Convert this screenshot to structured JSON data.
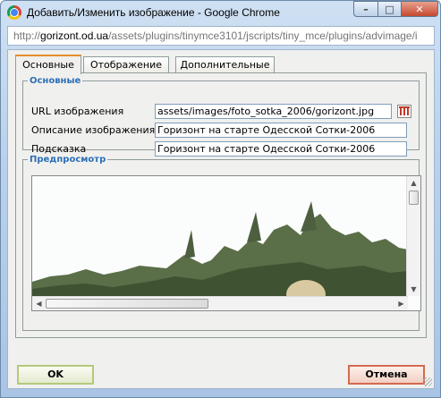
{
  "window": {
    "title": "Добавить/Изменить изображение - Google Chrome",
    "controls": {
      "minimize": "–",
      "maximize": "□",
      "close": "✕"
    }
  },
  "address_bar": {
    "prefix": "http://",
    "host": "gorizont.od.ua",
    "path": "/assets/plugins/tinymce3101/jscripts/tiny_mce/plugins/advimage/i"
  },
  "tabs": [
    {
      "label": "Основные",
      "active": true
    },
    {
      "label": "Отображение",
      "active": false
    },
    {
      "label": "Дополнительные",
      "active": false
    }
  ],
  "general": {
    "legend": "Основные",
    "url_label": "URL изображения",
    "url_value": "assets/images/foto_sotka_2006/gorizont.jpg",
    "desc_label": "Описание изображения",
    "desc_value": "Горизонт на старте Одесской Сотки-2006",
    "title_label": "Подсказка",
    "title_value": "Горизонт на старте Одесской Сотки-2006"
  },
  "preview": {
    "legend": "Предпросмотр"
  },
  "buttons": {
    "ok": "OK",
    "cancel": "Отмена"
  },
  "colors": {
    "legend_blue": "#2b6fb6",
    "active_tab_accent": "#e68b2c",
    "ok_border": "#b5c97a",
    "cancel_border": "#d46a50"
  },
  "icons": [
    "chrome-icon",
    "browse-icon",
    "scroll-arrow-icons",
    "resize-grip-icon"
  ]
}
